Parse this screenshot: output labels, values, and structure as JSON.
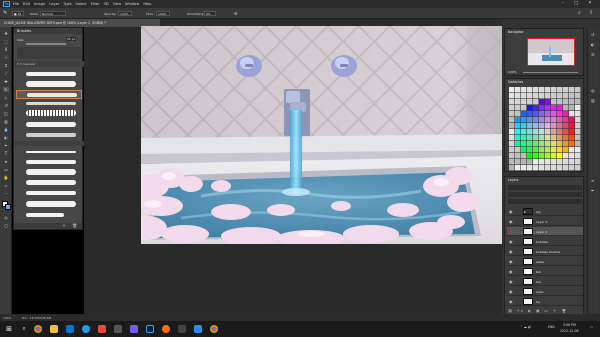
{
  "app": {
    "logo_text": "Ps",
    "menu": [
      "File",
      "Edit",
      "Image",
      "Layer",
      "Type",
      "Select",
      "Filter",
      "3D",
      "View",
      "Window",
      "Help"
    ]
  },
  "options_bar": {
    "mode_label": "Mode:",
    "mode_value": "Normal",
    "opacity_label": "Opacity:",
    "opacity_value": "100%",
    "flow_label": "Flow:",
    "flow_value": "100%",
    "smoothing_label": "Smoothing:",
    "smoothing_value": "0%"
  },
  "document": {
    "tab_title": "CHAIR_JACKIE WALLPAPER DEF9.psd @ 100% (Layer 2, RGB/8) *"
  },
  "brush_panel": {
    "title": "Brushes",
    "size_label": "Size:",
    "size_value": "55 px"
  },
  "navigator": {
    "title": "Navigator",
    "zoom": "100%"
  },
  "swatches": {
    "title": "Swatches"
  },
  "layers": {
    "title": "Layers",
    "items": [
      {
        "name": "sky"
      },
      {
        "name": "Layer 2"
      },
      {
        "name": "Layer 2"
      },
      {
        "name": "bubbles"
      },
      {
        "name": "bubbles shadow"
      },
      {
        "name": "water"
      },
      {
        "name": "tub"
      },
      {
        "name": "tub"
      },
      {
        "name": "walls"
      },
      {
        "name": "bg"
      }
    ]
  },
  "status": {
    "zoom": "100%",
    "doc": "Doc: 18.2M/246.6M"
  },
  "taskbar": {
    "time": "3:06 PM",
    "date": "2022-12-09",
    "lang": "ENG"
  },
  "colors": {
    "canvas_bg": "#2a2a2a",
    "panel_bg": "#3c3c3c",
    "accent_selection": "#d22222"
  }
}
